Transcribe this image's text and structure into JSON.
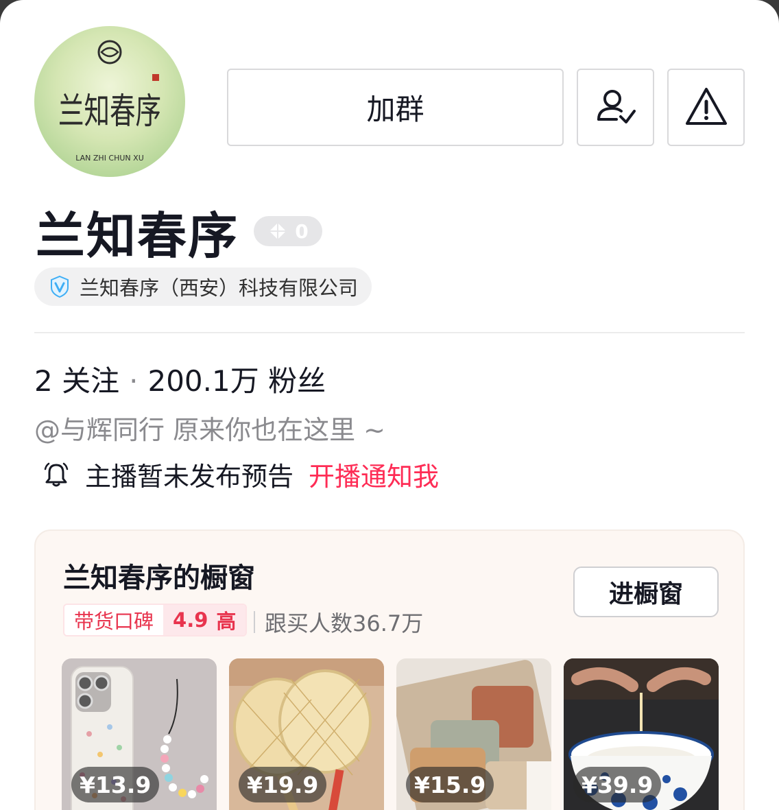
{
  "profile": {
    "avatar_logo_text": "兰知春序",
    "avatar_logo_sub": "LAN ZHI CHUN XU",
    "name": "兰知春序",
    "level": "0",
    "verified_company": "兰知春序（西安）科技有限公司"
  },
  "actions": {
    "join_group_label": "加群"
  },
  "stats": {
    "following_count": "2",
    "following_label": "关注",
    "separator": "·",
    "followers_count": "200.1万",
    "followers_label": "粉丝"
  },
  "bio": "@与辉同行 原来你也在这里 ~",
  "live_notice": {
    "status_text": "主播暂未发布预告",
    "notify_label": "开播通知我"
  },
  "shop": {
    "title": "兰知春序的橱窗",
    "enter_label": "进橱窗",
    "reputation_label": "带货口碑",
    "reputation_score": "4.9",
    "reputation_level": "高",
    "buyers_text": "跟买人数36.7万",
    "products": [
      {
        "price": "¥13.9",
        "kind": "phone-case"
      },
      {
        "price": "¥19.9",
        "kind": "woven-fan"
      },
      {
        "price": "¥15.9",
        "kind": "storage-bags"
      },
      {
        "price": "¥39.9",
        "kind": "porcelain-bowl"
      }
    ]
  },
  "colors": {
    "accent_red": "#fe2c55",
    "rating_red": "#e8344e",
    "verify_blue": "#3eaef5"
  }
}
